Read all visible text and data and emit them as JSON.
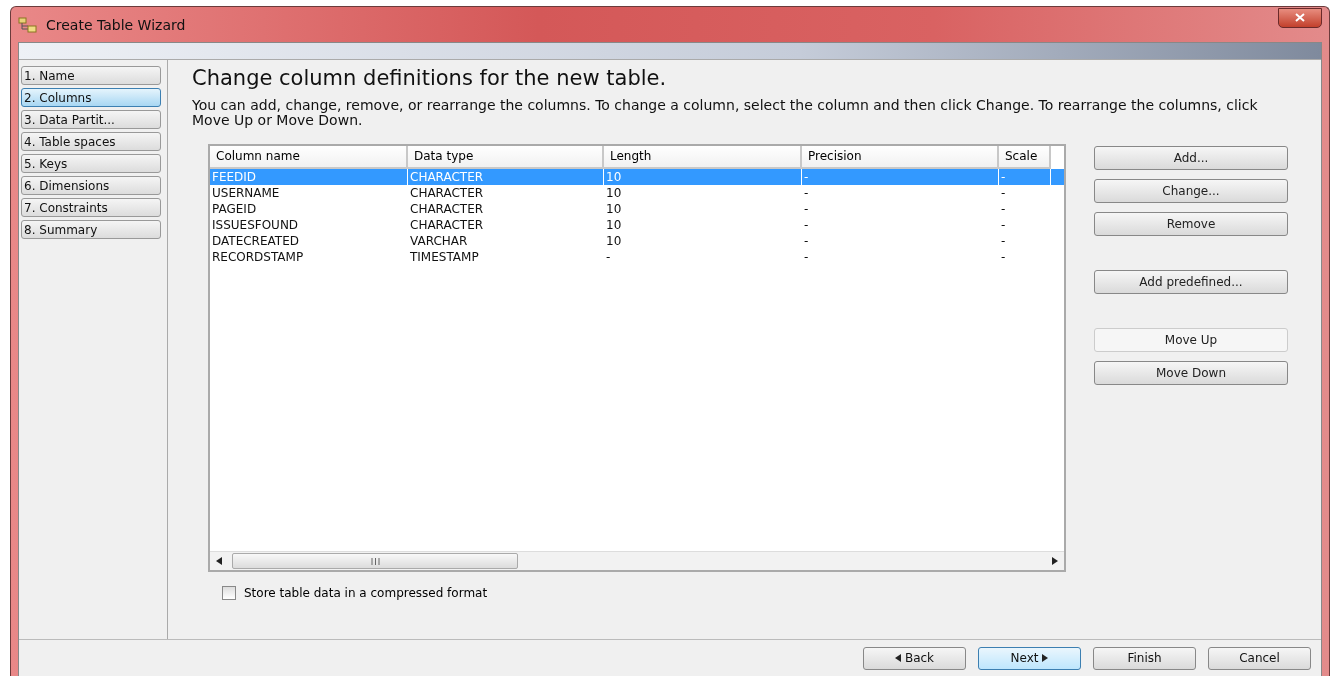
{
  "window": {
    "title": "Create Table Wizard"
  },
  "steps": [
    {
      "label": "1. Name",
      "selected": false
    },
    {
      "label": "2. Columns",
      "selected": true
    },
    {
      "label": "3. Data Partit...",
      "selected": false
    },
    {
      "label": "4. Table spaces",
      "selected": false
    },
    {
      "label": "5. Keys",
      "selected": false
    },
    {
      "label": "6. Dimensions",
      "selected": false
    },
    {
      "label": "7. Constraints",
      "selected": false
    },
    {
      "label": "8. Summary",
      "selected": false
    }
  ],
  "heading": "Change column definitions for the new table.",
  "description": "You can add, change, remove, or rearrange the columns. To change a column, select the column and then click Change. To rearrange the columns, click Move Up or Move Down.",
  "table": {
    "columns": [
      "Column name",
      "Data type",
      "Length",
      "Precision",
      "Scale"
    ],
    "rows": [
      {
        "cells": [
          "FEEDID",
          "CHARACTER",
          "10",
          "-",
          "-"
        ],
        "selected": true
      },
      {
        "cells": [
          "USERNAME",
          "CHARACTER",
          "10",
          "-",
          "-"
        ],
        "selected": false
      },
      {
        "cells": [
          "PAGEID",
          "CHARACTER",
          "10",
          "-",
          "-"
        ],
        "selected": false
      },
      {
        "cells": [
          "ISSUESFOUND",
          "CHARACTER",
          "10",
          "-",
          "-"
        ],
        "selected": false
      },
      {
        "cells": [
          "DATECREATED",
          "VARCHAR",
          "10",
          "-",
          "-"
        ],
        "selected": false
      },
      {
        "cells": [
          "RECORDSTAMP",
          "TIMESTAMP",
          "-",
          "-",
          "-"
        ],
        "selected": false
      }
    ]
  },
  "side_button_groups": [
    [
      {
        "label": "Add...",
        "disabled": false
      },
      {
        "label": "Change...",
        "disabled": false
      },
      {
        "label": "Remove",
        "disabled": false
      }
    ],
    [
      {
        "label": "Add predefined...",
        "disabled": false
      }
    ],
    [
      {
        "label": "Move Up",
        "disabled": true
      },
      {
        "label": "Move Down",
        "disabled": false
      }
    ]
  ],
  "compress": {
    "label": "Store table data in a compressed format",
    "checked": false
  },
  "nav_buttons": [
    {
      "label": "Back",
      "kind": "back",
      "default": false
    },
    {
      "label": "Next",
      "kind": "next",
      "default": true
    },
    {
      "label": "Finish",
      "kind": "plain",
      "default": false
    },
    {
      "label": "Cancel",
      "kind": "plain",
      "default": false
    }
  ]
}
